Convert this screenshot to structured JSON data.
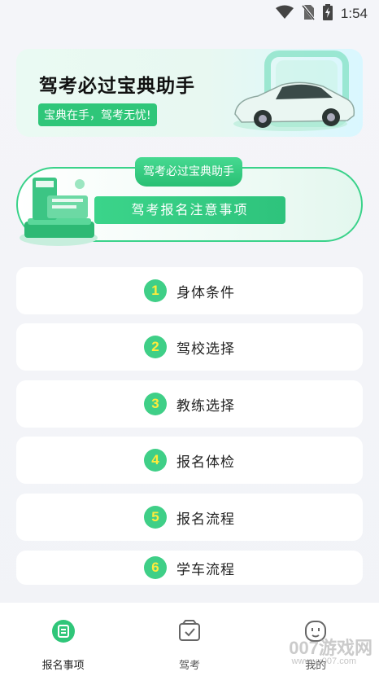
{
  "status_bar": {
    "time": "1:54",
    "icons": [
      "wifi-icon",
      "no-sim-icon",
      "battery-charging-icon"
    ]
  },
  "banner": {
    "title": "驾考必过宝典助手",
    "tag": "宝典在手，驾考无忧!",
    "art": "car-illustration"
  },
  "section": {
    "tab_label": "驾考必过宝典助手",
    "pill_label": "驾考报名注意事项",
    "art": "book-illustration"
  },
  "list": {
    "items": [
      {
        "num": "1",
        "label": "身体条件"
      },
      {
        "num": "2",
        "label": "驾校选择"
      },
      {
        "num": "3",
        "label": "教练选择"
      },
      {
        "num": "4",
        "label": "报名体检"
      },
      {
        "num": "5",
        "label": "报名流程"
      },
      {
        "num": "6",
        "label": "学车流程"
      }
    ]
  },
  "bottom_nav": {
    "items": [
      {
        "label": "报名事项",
        "icon": "document-icon",
        "active": true
      },
      {
        "label": "驾考",
        "icon": "checklist-icon",
        "active": false
      },
      {
        "label": "我的",
        "icon": "face-icon",
        "active": false
      }
    ]
  },
  "watermark": {
    "text": "007游戏网",
    "sub": "www.yx007.com"
  },
  "colors": {
    "accent": "#2fc679",
    "number_text": "#ffeb3b",
    "background": "#f3f4f8"
  }
}
